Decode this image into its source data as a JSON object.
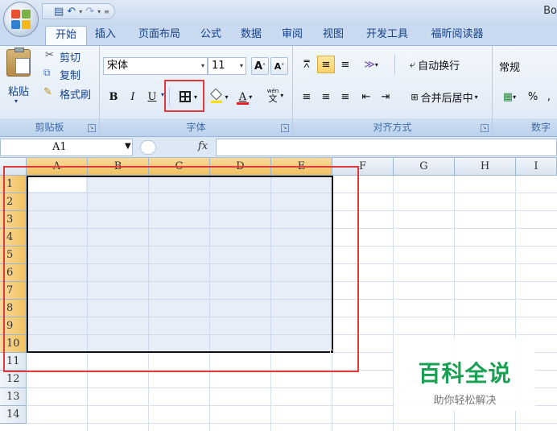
{
  "title": "Bo",
  "tabs": [
    "开始",
    "插入",
    "页面布局",
    "公式",
    "数据",
    "审阅",
    "视图",
    "开发工具",
    "福昕阅读器"
  ],
  "ribbon": {
    "clipboard": {
      "paste": "粘贴",
      "cut": "剪切",
      "copy": "复制",
      "format_painter": "格式刷",
      "label": "剪贴板"
    },
    "font": {
      "name": "宋体",
      "size": "11",
      "bold": "B",
      "italic": "I",
      "underline": "U",
      "grow": "A",
      "shrink": "A",
      "pinyin": "wén",
      "label": "字体"
    },
    "alignment": {
      "wrap": "自动换行",
      "merge": "合并后居中",
      "label": "对齐方式"
    },
    "number": {
      "format": "常规",
      "percent": "%",
      "label": "数字"
    }
  },
  "formula_bar": {
    "name_box": "A1",
    "fx": "fx",
    "value": ""
  },
  "columns": [
    "A",
    "B",
    "C",
    "D",
    "E",
    "F",
    "G",
    "H",
    "I"
  ],
  "rows": [
    "1",
    "2",
    "3",
    "4",
    "5",
    "6",
    "7",
    "8",
    "9",
    "10",
    "11",
    "12",
    "13",
    "14"
  ],
  "selection": {
    "range_start": "A1",
    "range_end": "E10"
  },
  "watermark": {
    "title": "百科全说",
    "subtitle": "助你轻松解决"
  },
  "colors": {
    "accent_highlight": "#e03a3a",
    "header_selected": "#f1c15f",
    "selection_fill": "#dce3f3",
    "watermark_green": "#1aa052"
  }
}
